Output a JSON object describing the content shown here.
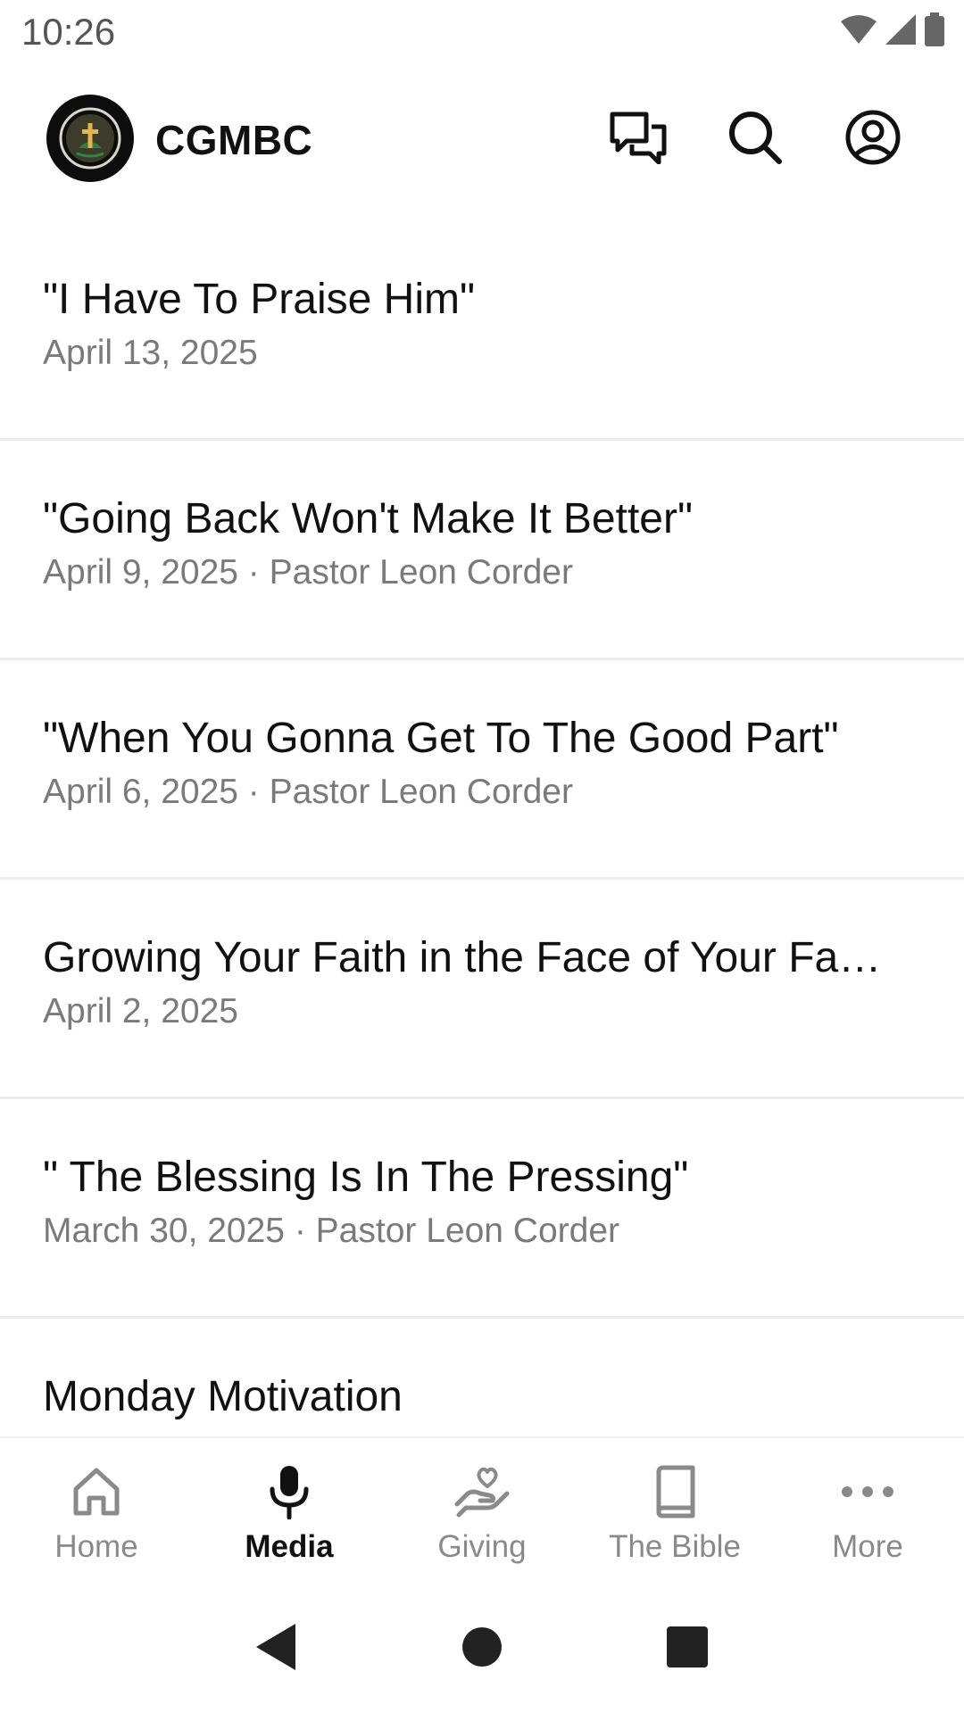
{
  "status_bar": {
    "time": "10:26",
    "icons": [
      "wifi-icon",
      "signal-icon",
      "battery-icon"
    ]
  },
  "header": {
    "brand": "CGMBC",
    "logo_icon": "church-logo-icon",
    "actions": [
      "chat-icon",
      "search-icon",
      "profile-icon"
    ]
  },
  "media_list": [
    {
      "title": "\"I Have  To Praise Him\"",
      "subtitle": "April 13, 2025"
    },
    {
      "title": "\"Going Back Won't Make It Better\"",
      "subtitle": "April 9, 2025 · Pastor Leon Corder"
    },
    {
      "title": "\"When You Gonna Get To The Good Part\"",
      "subtitle": "April 6, 2025 · Pastor Leon Corder"
    },
    {
      "title": "Growing Your Faith in the Face of Your Fa…",
      "subtitle": "April 2, 2025"
    },
    {
      "title": "\" The Blessing Is In The Pressing\"",
      "subtitle": "March 30, 2025 · Pastor Leon Corder"
    },
    {
      "title": "Monday Motivation",
      "subtitle": ""
    }
  ],
  "bottom_nav": {
    "items": [
      {
        "label": "Home",
        "icon": "home-icon",
        "active": false
      },
      {
        "label": "Media",
        "icon": "microphone-icon",
        "active": true
      },
      {
        "label": "Giving",
        "icon": "giving-hand-heart-icon",
        "active": false
      },
      {
        "label": "The Bible",
        "icon": "book-icon",
        "active": false
      },
      {
        "label": "More",
        "icon": "more-dots-icon",
        "active": false
      }
    ]
  },
  "system_nav": [
    "back-icon",
    "home-circle-icon",
    "recents-icon"
  ],
  "colors": {
    "primary_text": "#111111",
    "secondary_text": "#7a7a7a",
    "inactive_nav": "#8a8a8a",
    "divider": "#ececec"
  }
}
